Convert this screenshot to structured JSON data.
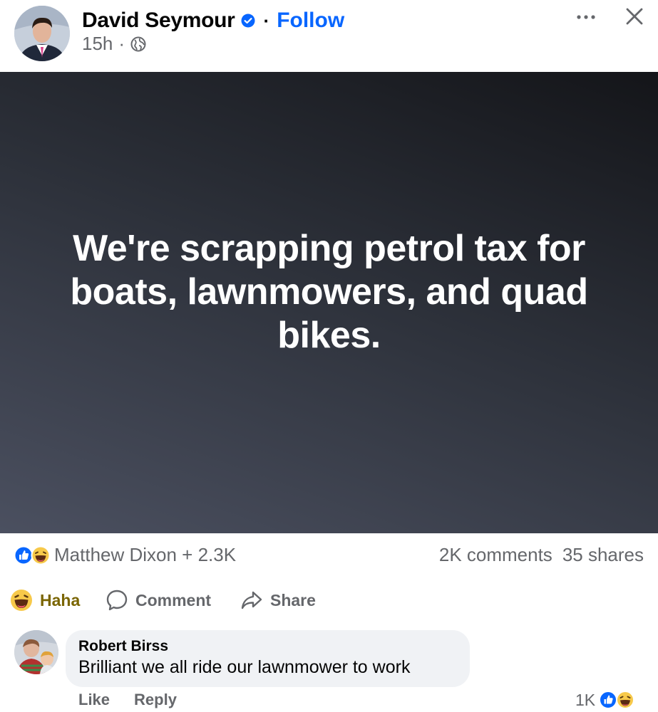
{
  "post": {
    "author": "David Seymour",
    "verified_icon": "verified-badge-icon",
    "separator": "·",
    "follow_label": "Follow",
    "time": "15h",
    "audience_icon": "globe-icon",
    "text": "We're scrapping petrol tax for boats, lawnmowers, and quad bikes.",
    "colors": {
      "follow": "#0866ff",
      "banner_top": "#141519",
      "banner_bottom": "#4b5060"
    }
  },
  "stats": {
    "reaction_icons": [
      "like-icon",
      "haha-icon"
    ],
    "reactors": "Matthew Dixon + 2.3K",
    "comments": "2K comments",
    "shares": "35 shares"
  },
  "actions": {
    "haha_label": "Haha",
    "comment_label": "Comment",
    "share_label": "Share"
  },
  "comment": {
    "author": "Robert Birss",
    "text": "Brilliant we all ride our lawnmower to work",
    "like_label": "Like",
    "reply_label": "Reply",
    "reaction_count": "1K",
    "reaction_icons": [
      "like-icon",
      "haha-icon"
    ]
  }
}
